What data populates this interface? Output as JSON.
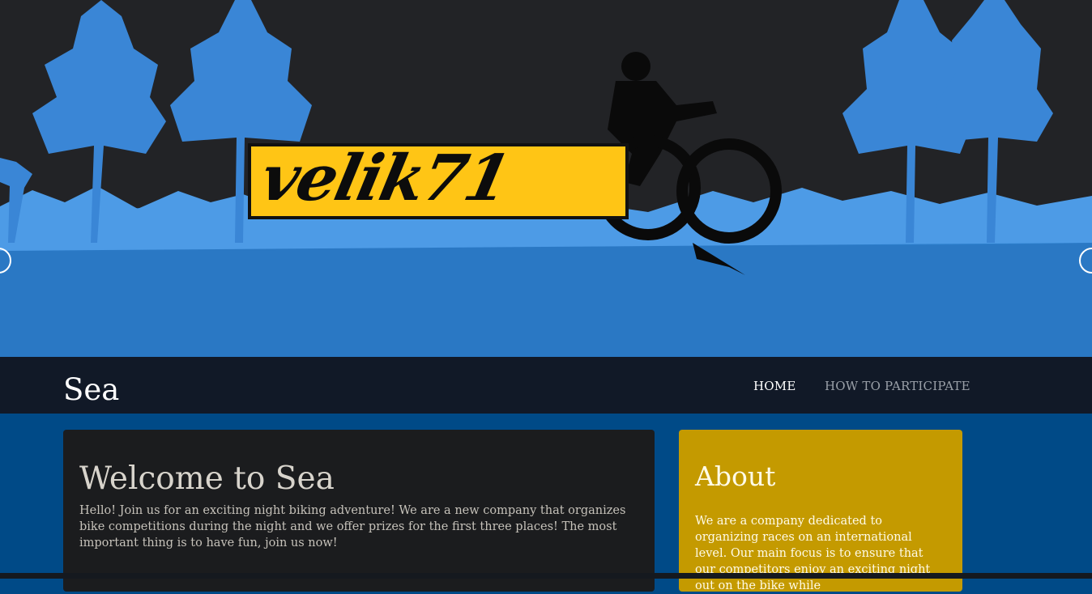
{
  "hero": {
    "logo_text": "velik71",
    "colors": {
      "sky": "#222326",
      "trees": "#2f80d0",
      "ground": "#2d7fcc",
      "logo_bg": "#ffc515"
    }
  },
  "navbar": {
    "brand": "Sea",
    "items": [
      {
        "label": "HOME",
        "active": true
      },
      {
        "label": "HOW TO PARTICIPATE",
        "active": false
      }
    ]
  },
  "welcome": {
    "title": "Welcome to Sea",
    "text": "Hello! Join us for an exciting night biking adventure! We are a new company that organizes bike competitions during the night and we offer prizes for the first three places! The most important thing is to have fun, join us now!"
  },
  "about": {
    "title": "About",
    "text": "We are a company dedicated to organizing races on an international level. Our main focus is to ensure that our competitors enjoy an exciting night out on the bike while"
  },
  "colors": {
    "page_bg": "#004a87",
    "navbar_bg": "#111927",
    "welcome_card": "#1b1c1e",
    "about_card": "#c49a00"
  }
}
